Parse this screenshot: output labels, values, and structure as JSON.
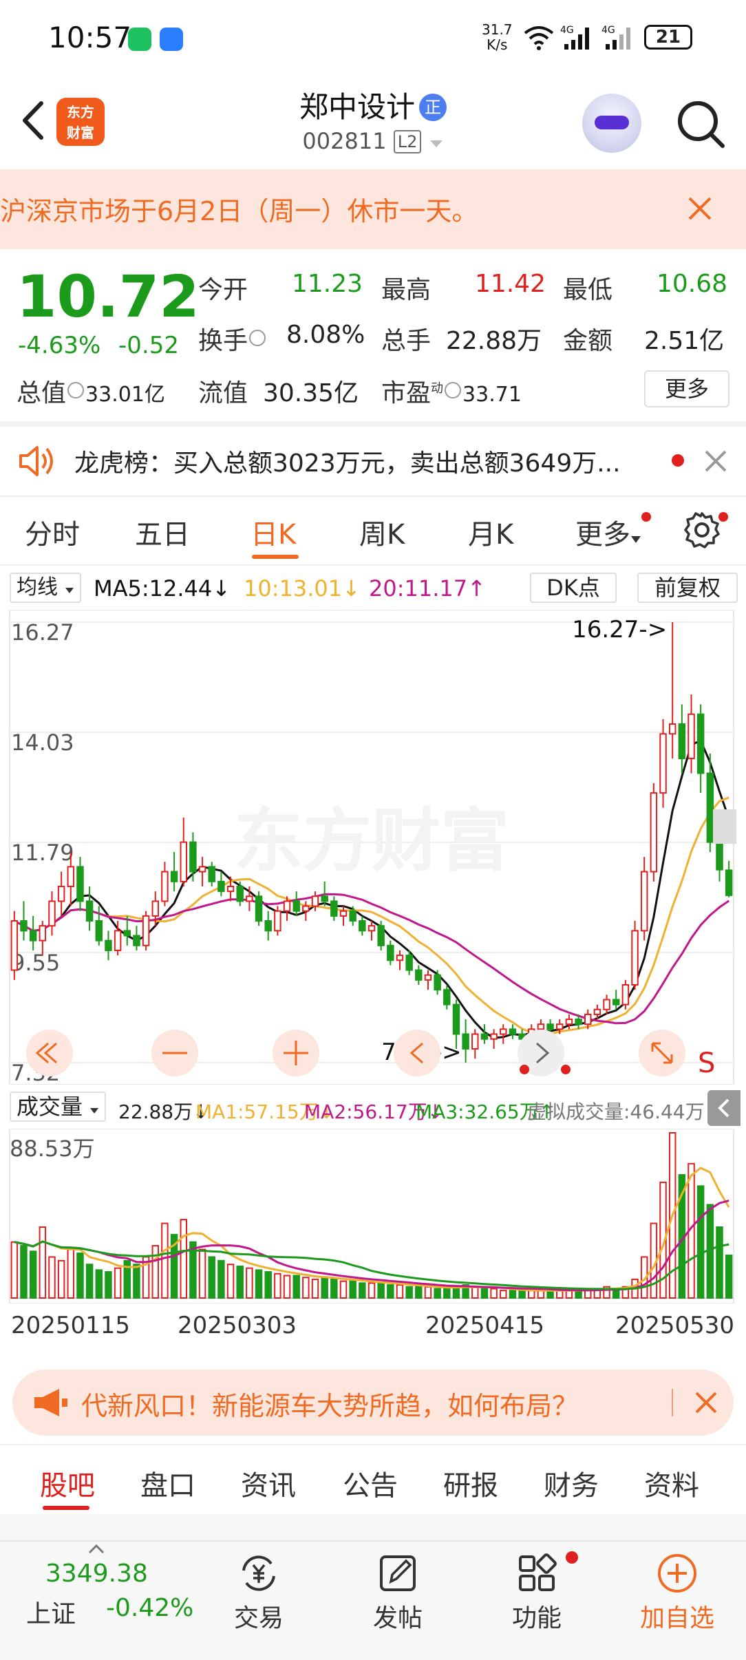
{
  "status_bar": {
    "time": "10:57",
    "speed_value": "31.7",
    "speed_unit": "K/s",
    "net1": "4G",
    "net2": "4G",
    "battery": "21"
  },
  "header": {
    "logo_text_line1": "东方",
    "logo_text_line2": "财富",
    "stock_name": "郑中设计",
    "stock_badge": "正",
    "stock_code": "002811",
    "level_badge": "L2"
  },
  "notice": {
    "text": "沪深京市场于6月2日（周一）休市一天。"
  },
  "quote": {
    "price": "10.72",
    "change_pct": "-4.63%",
    "change_amt": "-0.52",
    "open_label": "今开",
    "open_value": "11.23",
    "high_label": "最高",
    "high_value": "11.42",
    "low_label": "最低",
    "low_value": "10.68",
    "turnover_label": "换手",
    "turnover_value": "8.08%",
    "volume_label": "总手",
    "volume_value": "22.88万",
    "amount_label": "金额",
    "amount_value": "2.51亿",
    "mktcap_label": "总值",
    "mktcap_value": "33.01亿",
    "float_label": "流值",
    "float_value": "30.35亿",
    "pe_label": "市盈",
    "pe_sup": "动",
    "pe_value": "33.71",
    "more_label": "更多"
  },
  "dragon_tiger": {
    "text": "龙虎榜：买入总额3023万元，卖出总额3649万..."
  },
  "kline_tabs": [
    {
      "label": "分时"
    },
    {
      "label": "五日"
    },
    {
      "label": "日K"
    },
    {
      "label": "周K"
    },
    {
      "label": "月K"
    },
    {
      "label": "更多"
    }
  ],
  "ma_bar": {
    "selector": "均线",
    "ma5": "MA5:12.44↓",
    "ma10": "10:13.01↓",
    "ma20": "20:11.17↑",
    "dk_label": "DK点",
    "adjust_label": "前复权"
  },
  "colors": {
    "up": "#e0201e",
    "down": "#1b9a1b",
    "ma5": "#111111",
    "ma10": "#f0b030",
    "ma20": "#c0188a",
    "accent": "#ef6b23"
  },
  "chart_data": [
    {
      "type": "candlestick",
      "title": "",
      "y_tick_labels": [
        "16.27",
        "14.03",
        "11.79",
        "9.55",
        "7.32"
      ],
      "ylim": [
        7.32,
        16.27
      ],
      "max_label": "16.27->",
      "min_label": "7.32->",
      "watermark": "东方财富",
      "ohlc": [
        [
          9.2,
          10.4,
          9.0,
          10.2
        ],
        [
          10.2,
          10.6,
          9.8,
          10.0
        ],
        [
          10.0,
          10.3,
          9.6,
          9.8
        ],
        [
          9.8,
          10.2,
          9.5,
          10.1
        ],
        [
          10.1,
          10.8,
          9.9,
          10.6
        ],
        [
          10.6,
          11.2,
          10.3,
          10.9
        ],
        [
          10.9,
          11.6,
          10.5,
          11.3
        ],
        [
          11.3,
          11.5,
          10.4,
          10.6
        ],
        [
          10.6,
          10.9,
          10.0,
          10.2
        ],
        [
          10.2,
          10.5,
          9.7,
          9.8
        ],
        [
          9.8,
          10.0,
          9.4,
          9.6
        ],
        [
          9.6,
          10.2,
          9.5,
          10.0
        ],
        [
          10.0,
          10.3,
          9.7,
          9.9
        ],
        [
          9.9,
          10.1,
          9.6,
          9.7
        ],
        [
          9.7,
          10.4,
          9.6,
          10.3
        ],
        [
          10.3,
          10.8,
          10.1,
          10.6
        ],
        [
          10.6,
          11.4,
          10.5,
          11.2
        ],
        [
          11.2,
          11.6,
          10.8,
          11.0
        ],
        [
          11.0,
          12.3,
          10.9,
          11.8
        ],
        [
          11.8,
          12.0,
          11.0,
          11.2
        ],
        [
          11.2,
          11.5,
          10.9,
          11.3
        ],
        [
          11.3,
          11.4,
          10.9,
          11.0
        ],
        [
          11.0,
          11.2,
          10.7,
          10.8
        ],
        [
          10.8,
          11.1,
          10.6,
          10.9
        ],
        [
          10.9,
          11.0,
          10.5,
          10.6
        ],
        [
          10.6,
          10.9,
          10.4,
          10.7
        ],
        [
          10.7,
          10.8,
          10.1,
          10.2
        ],
        [
          10.2,
          10.4,
          9.8,
          10.0
        ],
        [
          10.0,
          10.5,
          9.9,
          10.4
        ],
        [
          10.4,
          10.7,
          10.2,
          10.6
        ],
        [
          10.6,
          10.8,
          10.3,
          10.4
        ],
        [
          10.4,
          10.6,
          10.2,
          10.5
        ],
        [
          10.5,
          10.8,
          10.4,
          10.7
        ],
        [
          10.7,
          11.0,
          10.5,
          10.6
        ],
        [
          10.6,
          10.7,
          10.2,
          10.3
        ],
        [
          10.3,
          10.5,
          10.1,
          10.4
        ],
        [
          10.4,
          10.5,
          10.1,
          10.2
        ],
        [
          10.2,
          10.3,
          9.9,
          10.0
        ],
        [
          10.0,
          10.2,
          9.8,
          10.1
        ],
        [
          10.1,
          10.2,
          9.6,
          9.7
        ],
        [
          9.7,
          9.8,
          9.3,
          9.4
        ],
        [
          9.4,
          9.6,
          9.2,
          9.5
        ],
        [
          9.5,
          9.6,
          9.1,
          9.2
        ],
        [
          9.2,
          9.3,
          8.9,
          9.0
        ],
        [
          9.0,
          9.2,
          8.8,
          9.1
        ],
        [
          9.1,
          9.2,
          8.7,
          8.8
        ],
        [
          8.8,
          8.9,
          8.4,
          8.5
        ],
        [
          8.5,
          8.6,
          7.6,
          7.9
        ],
        [
          7.9,
          8.2,
          7.32,
          7.6
        ],
        [
          7.6,
          8.0,
          7.4,
          7.9
        ],
        [
          7.9,
          8.1,
          7.7,
          7.8
        ],
        [
          7.8,
          8.0,
          7.6,
          7.9
        ],
        [
          7.9,
          8.1,
          7.7,
          8.0
        ],
        [
          8.0,
          8.1,
          7.8,
          7.9
        ],
        [
          7.9,
          8.0,
          7.7,
          7.8
        ],
        [
          7.8,
          8.1,
          7.7,
          8.0
        ],
        [
          8.0,
          8.2,
          7.9,
          8.1
        ],
        [
          8.1,
          8.2,
          7.9,
          8.0
        ],
        [
          8.0,
          8.2,
          7.9,
          8.1
        ],
        [
          8.1,
          8.3,
          8.0,
          8.2
        ],
        [
          8.2,
          8.3,
          8.0,
          8.1
        ],
        [
          8.1,
          8.4,
          8.0,
          8.3
        ],
        [
          8.3,
          8.5,
          8.2,
          8.4
        ],
        [
          8.4,
          8.7,
          8.3,
          8.6
        ],
        [
          8.6,
          8.8,
          8.4,
          8.5
        ],
        [
          8.5,
          9.0,
          8.4,
          8.9
        ],
        [
          8.9,
          10.2,
          8.8,
          10.0
        ],
        [
          10.0,
          11.5,
          9.8,
          11.2
        ],
        [
          11.2,
          13.0,
          11.0,
          12.8
        ],
        [
          12.8,
          14.3,
          12.5,
          14.0
        ],
        [
          14.0,
          16.27,
          13.5,
          14.2
        ],
        [
          14.2,
          14.6,
          13.2,
          13.5
        ],
        [
          13.5,
          14.8,
          13.2,
          14.4
        ],
        [
          14.4,
          14.6,
          12.8,
          13.2
        ],
        [
          13.2,
          13.6,
          11.6,
          11.8
        ],
        [
          11.8,
          12.0,
          11.0,
          11.24
        ],
        [
          11.23,
          11.42,
          10.68,
          10.72
        ]
      ]
    },
    {
      "type": "bar",
      "title": "",
      "selector": "成交量",
      "vol_text": "22.88万↓",
      "ma1_text": "MA1:57.15万↓",
      "ma2_text": "MA2:56.17万↓",
      "ma3_text": "MA3:32.65万↑",
      "virtual_text": "虚拟成交量:46.44万",
      "max_label": "88.53万",
      "ylim": [
        0,
        88.53
      ],
      "x_tick_labels": [
        "20250115",
        "20250303",
        "20250415",
        "20250530"
      ],
      "volumes": [
        30,
        28,
        25,
        38,
        22,
        20,
        26,
        24,
        18,
        15,
        14,
        16,
        20,
        18,
        22,
        28,
        40,
        34,
        42,
        30,
        26,
        22,
        20,
        18,
        17,
        16,
        15,
        14,
        13,
        12,
        12,
        11,
        10,
        11,
        10,
        9,
        9,
        8,
        8,
        8,
        7,
        7,
        6,
        6,
        6,
        5,
        5,
        6,
        7,
        6,
        5,
        5,
        4,
        4,
        4,
        4,
        4,
        4,
        4,
        4,
        4,
        5,
        5,
        6,
        5,
        6,
        10,
        22,
        40,
        62,
        88.53,
        66,
        72,
        60,
        50,
        38,
        22.88
      ]
    }
  ],
  "ad": {
    "text": "代新风口！新能源车大势所趋，如何布局？"
  },
  "content_tabs": [
    {
      "label": "股吧"
    },
    {
      "label": "盘口"
    },
    {
      "label": "资讯"
    },
    {
      "label": "公告"
    },
    {
      "label": "研报"
    },
    {
      "label": "财务"
    },
    {
      "label": "资料"
    }
  ],
  "bottom_nav": {
    "index_value": "3349.38",
    "index_name": "上证",
    "index_change": "-0.42%",
    "trade_label": "交易",
    "post_label": "发帖",
    "function_label": "功能",
    "add_label": "加自选"
  }
}
